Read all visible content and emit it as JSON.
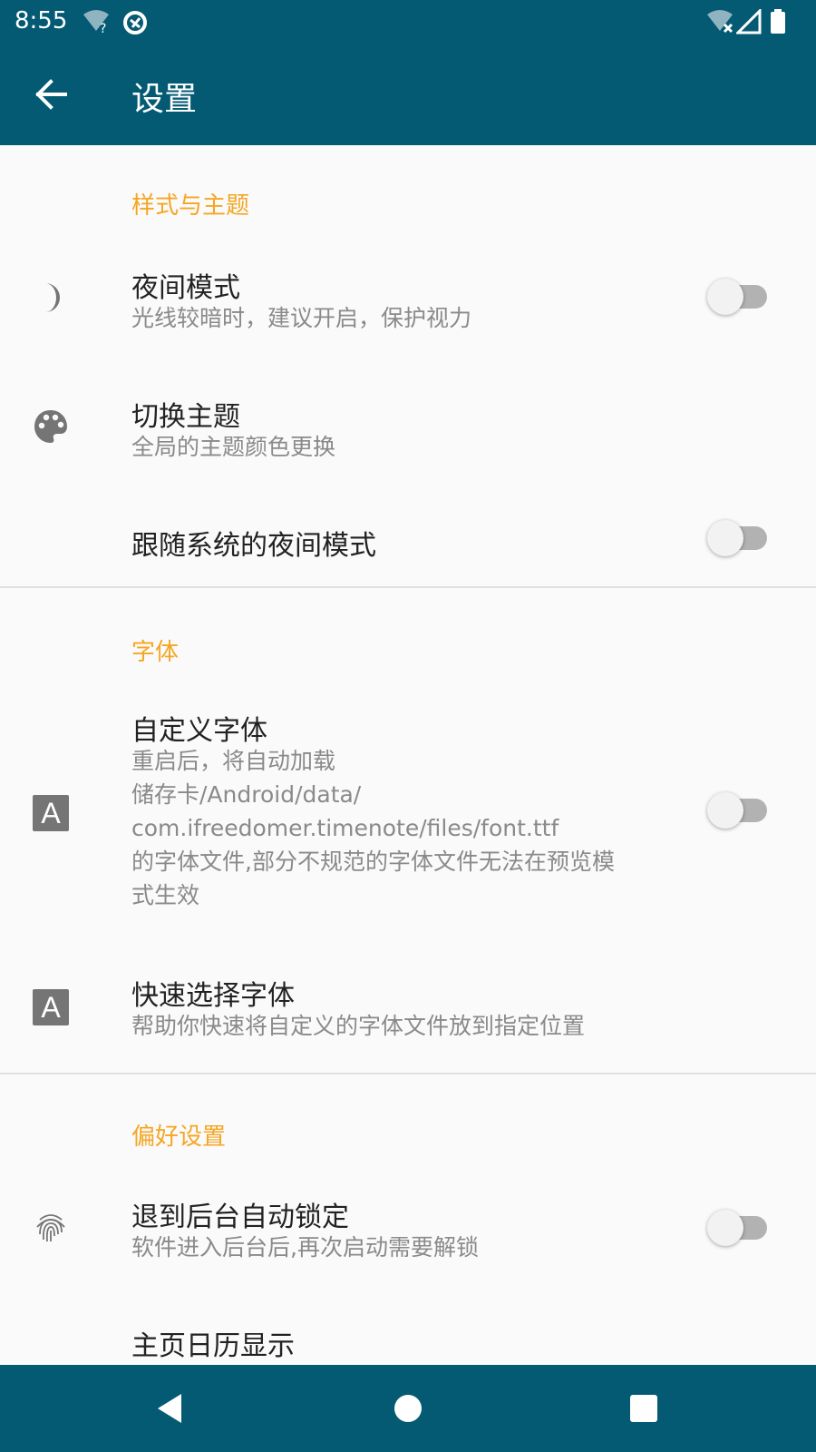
{
  "status_bar": {
    "time": "8:55",
    "icons": [
      "wifi-question-icon",
      "vpn-icon",
      "wifi-off-icon",
      "signal-icon",
      "battery-icon"
    ]
  },
  "app_bar": {
    "title": "设置",
    "back_icon": "arrow-back-icon"
  },
  "colors": {
    "primary": "#045a73",
    "accent": "#f5a623",
    "background": "#fafafa",
    "title_text": "#222222",
    "subtitle_text": "#8a8a8a",
    "icon": "#757575"
  },
  "sections": [
    {
      "title": "样式与主题",
      "items": [
        {
          "title": "夜间模式",
          "subtitle": "光线较暗时，建议开启，保护视力",
          "icon": "moon-icon",
          "switch": false
        },
        {
          "title": "切换主题",
          "subtitle": "全局的主题颜色更换",
          "icon": "palette-icon"
        },
        {
          "title": "跟随系统的夜间模式",
          "switch": false
        }
      ]
    },
    {
      "title": "字体",
      "items": [
        {
          "title": "自定义字体",
          "subtitle": "重启后，将自动加载\n储存卡/Android/data/\ncom.ifreedomer.timenote/files/font.ttf\n的字体文件,部分不规范的字体文件无法在预览模\n式生效",
          "icon": "font-a-icon",
          "icon_letter": "A",
          "switch": false
        },
        {
          "title": "快速选择字体",
          "subtitle": "帮助你快速将自定义的字体文件放到指定位置",
          "icon": "font-a-icon",
          "icon_letter": "A"
        }
      ]
    },
    {
      "title": "偏好设置",
      "items": [
        {
          "title": "退到后台自动锁定",
          "subtitle": "软件进入后台后,再次启动需要解锁",
          "icon": "fingerprint-icon",
          "switch": false
        },
        {
          "title": "主页日历显示"
        }
      ]
    }
  ],
  "nav_bar": {
    "icons": [
      "nav-back-icon",
      "nav-home-icon",
      "nav-recents-icon"
    ]
  }
}
